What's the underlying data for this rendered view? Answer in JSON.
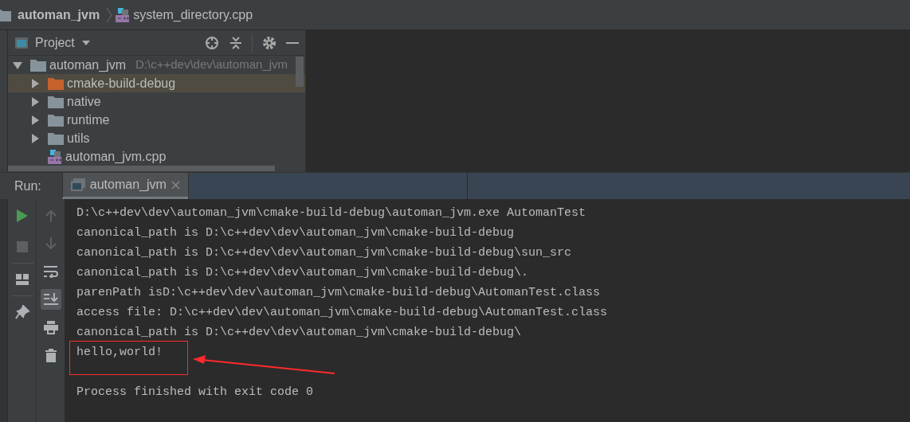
{
  "breadcrumb": [
    {
      "label": "automan_jvm",
      "kind": "folder"
    },
    {
      "label": "system_directory.cpp",
      "kind": "cpp"
    }
  ],
  "project_panel": {
    "title": "Project",
    "tree": [
      {
        "label": "automan_jvm",
        "path": "D:\\c++dev\\dev\\automan_jvm",
        "kind": "folder",
        "expanded": true,
        "selected": false,
        "children": [
          {
            "label": "cmake-build-debug",
            "kind": "build_folder",
            "expanded": false,
            "selected": true
          },
          {
            "label": "native",
            "kind": "folder",
            "expanded": false,
            "selected": false
          },
          {
            "label": "runtime",
            "kind": "folder",
            "expanded": false,
            "selected": false
          },
          {
            "label": "utils",
            "kind": "folder",
            "expanded": false,
            "selected": false
          },
          {
            "label": "automan_jvm.cpp",
            "kind": "cpp",
            "selected": false
          }
        ]
      }
    ]
  },
  "run_panel": {
    "label": "Run:",
    "tabs": [
      {
        "label": "automan_jvm",
        "selected": true
      }
    ],
    "toolbar_left": [
      {
        "kind": "run",
        "disabled": false
      },
      {
        "kind": "stop",
        "disabled": true
      },
      {
        "kind": "layout",
        "disabled": false
      },
      {
        "kind": "pin",
        "disabled": false
      }
    ],
    "toolbar_right": [
      {
        "kind": "up",
        "disabled": true
      },
      {
        "kind": "down",
        "disabled": true
      },
      {
        "kind": "wrap",
        "disabled": false,
        "selected": false
      },
      {
        "kind": "scroll_end",
        "disabled": false,
        "selected": true
      },
      {
        "kind": "print",
        "disabled": false
      },
      {
        "kind": "trash",
        "disabled": false
      }
    ],
    "console": [
      {
        "text": "D:\\c++dev\\dev\\automan_jvm\\cmake-build-debug\\automan_jvm.exe AutomanTest"
      },
      {
        "text": "canonical_path is D:\\c++dev\\dev\\automan_jvm\\cmake-build-debug"
      },
      {
        "text": "canonical_path is D:\\c++dev\\dev\\automan_jvm\\cmake-build-debug\\sun_src"
      },
      {
        "text": "canonical_path is D:\\c++dev\\dev\\automan_jvm\\cmake-build-debug\\."
      },
      {
        "text": "parenPath isD:\\c++dev\\dev\\automan_jvm\\cmake-build-debug\\AutomanTest.class"
      },
      {
        "text": "access file: D:\\c++dev\\dev\\automan_jvm\\cmake-build-debug\\AutomanTest.class"
      },
      {
        "text": "canonical_path is D:\\c++dev\\dev\\automan_jvm\\cmake-build-debug\\"
      },
      {
        "text": "hello,world!",
        "highlighted": true
      },
      {
        "text": "Process finished with exit code 0",
        "blank_line_before": true
      }
    ]
  }
}
